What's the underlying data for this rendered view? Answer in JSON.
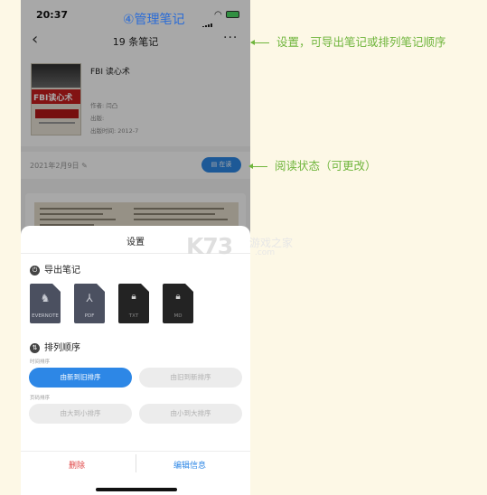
{
  "caption": "④管理笔记",
  "status_bar": {
    "time": "20:37"
  },
  "nav": {
    "back": "‹",
    "title": "19 条笔记",
    "more": "···"
  },
  "book": {
    "cover_title": "FBI读心术",
    "name": "FBI 读心术",
    "author": "作者: 闫凸",
    "publisher": "出版:",
    "pub_date": "出版时间: 2012-7"
  },
  "date_row": {
    "date": "2021年2月9日",
    "reading_button": "在读"
  },
  "settings": {
    "title": "设置",
    "export_section": "导出笔记",
    "export_formats": [
      {
        "label": "EVERNOTE",
        "icon": "evernote-icon"
      },
      {
        "label": "PDF",
        "icon": "pdf-icon"
      },
      {
        "label": "TXT",
        "icon": "lock-icon"
      },
      {
        "label": "MD",
        "icon": "lock-icon"
      }
    ],
    "sort_section": "排列顺序",
    "time_sort_label": "时间排序",
    "time_sort": [
      "由新到旧排序",
      "由旧到新排序"
    ],
    "page_sort_label": "页码排序",
    "page_sort": [
      "由大到小排序",
      "由小到大排序"
    ],
    "delete": "删除",
    "edit": "编辑信息"
  },
  "watermark": {
    "logo": "K73",
    "text": "游戏之家",
    "domain": ".com"
  },
  "annotations": {
    "settings_note": "设置，可导出笔记或排列笔记顺序",
    "status_note": "阅读状态（可更改）"
  },
  "colors": {
    "accent": "#2d87e6",
    "annotation": "#6fb53c",
    "delete": "#e04545",
    "caption": "#2b6cd6"
  }
}
